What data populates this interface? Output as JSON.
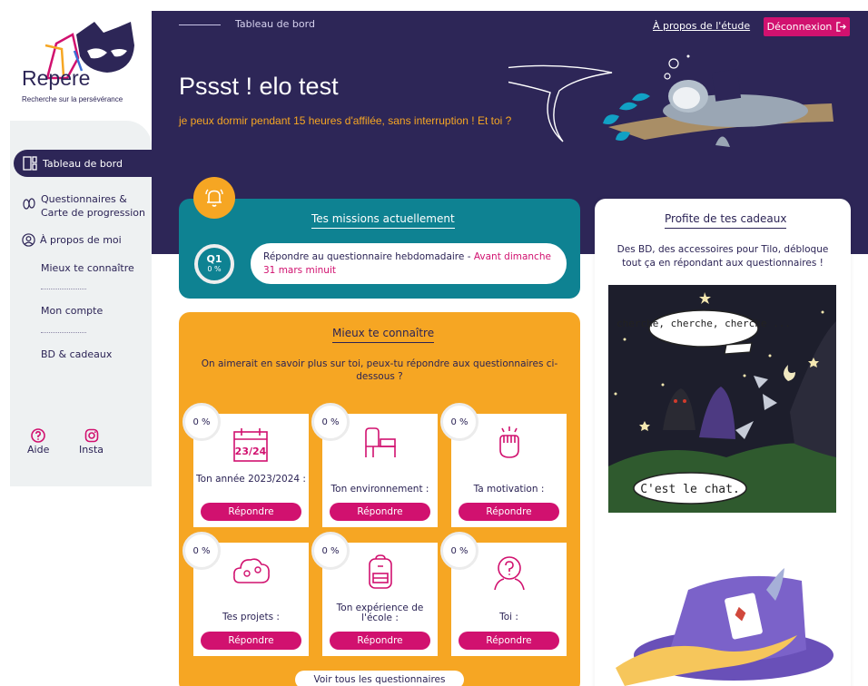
{
  "logo": {
    "text": "Repere",
    "tagline": "Recherche sur la persévérance"
  },
  "header": {
    "breadcrumb": "Tableau de bord",
    "about_link": "À propos de l'étude",
    "logout_label": "Déconnexion",
    "title": "Pssst ! elo test",
    "subtitle": "je peux dormir pendant 15 heures d'affilée, sans interruption ! Et toi ?"
  },
  "sidebar": {
    "active_item": "Tableau de bord",
    "questionnaires": "Questionnaires &",
    "progression": "Carte de progression",
    "about_me": "À propos de moi",
    "sub_items": [
      "Mieux te connaître",
      "Mon compte",
      "BD & cadeaux"
    ],
    "help": "Aide",
    "insta": "Insta"
  },
  "missions": {
    "title": "Tes missions actuellement",
    "badge_code": "Q1",
    "badge_pct": "0 %",
    "text": "Répondre au questionnaire hebdomadaire - ",
    "due": "Avant dimanche 31 mars minuit"
  },
  "quests": {
    "title": "Mieux te connaître",
    "description": "On aimerait en savoir plus sur toi, peux-tu répondre aux questionnaires ci-dessous ?",
    "button_label": "Répondre",
    "see_all": "Voir tous les questionnaires",
    "calendar_text": "23/24",
    "items": [
      {
        "pct": "0 %",
        "label": "Ton année 2023/2024 :",
        "icon": "calendar-icon"
      },
      {
        "pct": "0 %",
        "label": "Ton environnement :",
        "icon": "furniture-icon"
      },
      {
        "pct": "0 %",
        "label": "Ta motivation :",
        "icon": "fist-icon"
      },
      {
        "pct": "0 %",
        "label": "Tes projets :",
        "icon": "cloud-ideas-icon"
      },
      {
        "pct": "0 %",
        "label": "Ton expérience de l'école :",
        "icon": "backpack-icon"
      },
      {
        "pct": "0 %",
        "label": "Toi :",
        "icon": "person-question-icon"
      }
    ]
  },
  "gifts": {
    "title": "Profite de tes cadeaux",
    "description": "Des BD, des accessoires pour Tilo, débloque tout ça en répondant aux questionnaires !",
    "comic_bubble_1": "cherche, cherche, cherche ...",
    "comic_bubble_2": "C'est le chat."
  },
  "colors": {
    "purple": "#2d2657",
    "teal": "#0e8292",
    "orange": "#f6a623",
    "magenta": "#d1116f"
  }
}
